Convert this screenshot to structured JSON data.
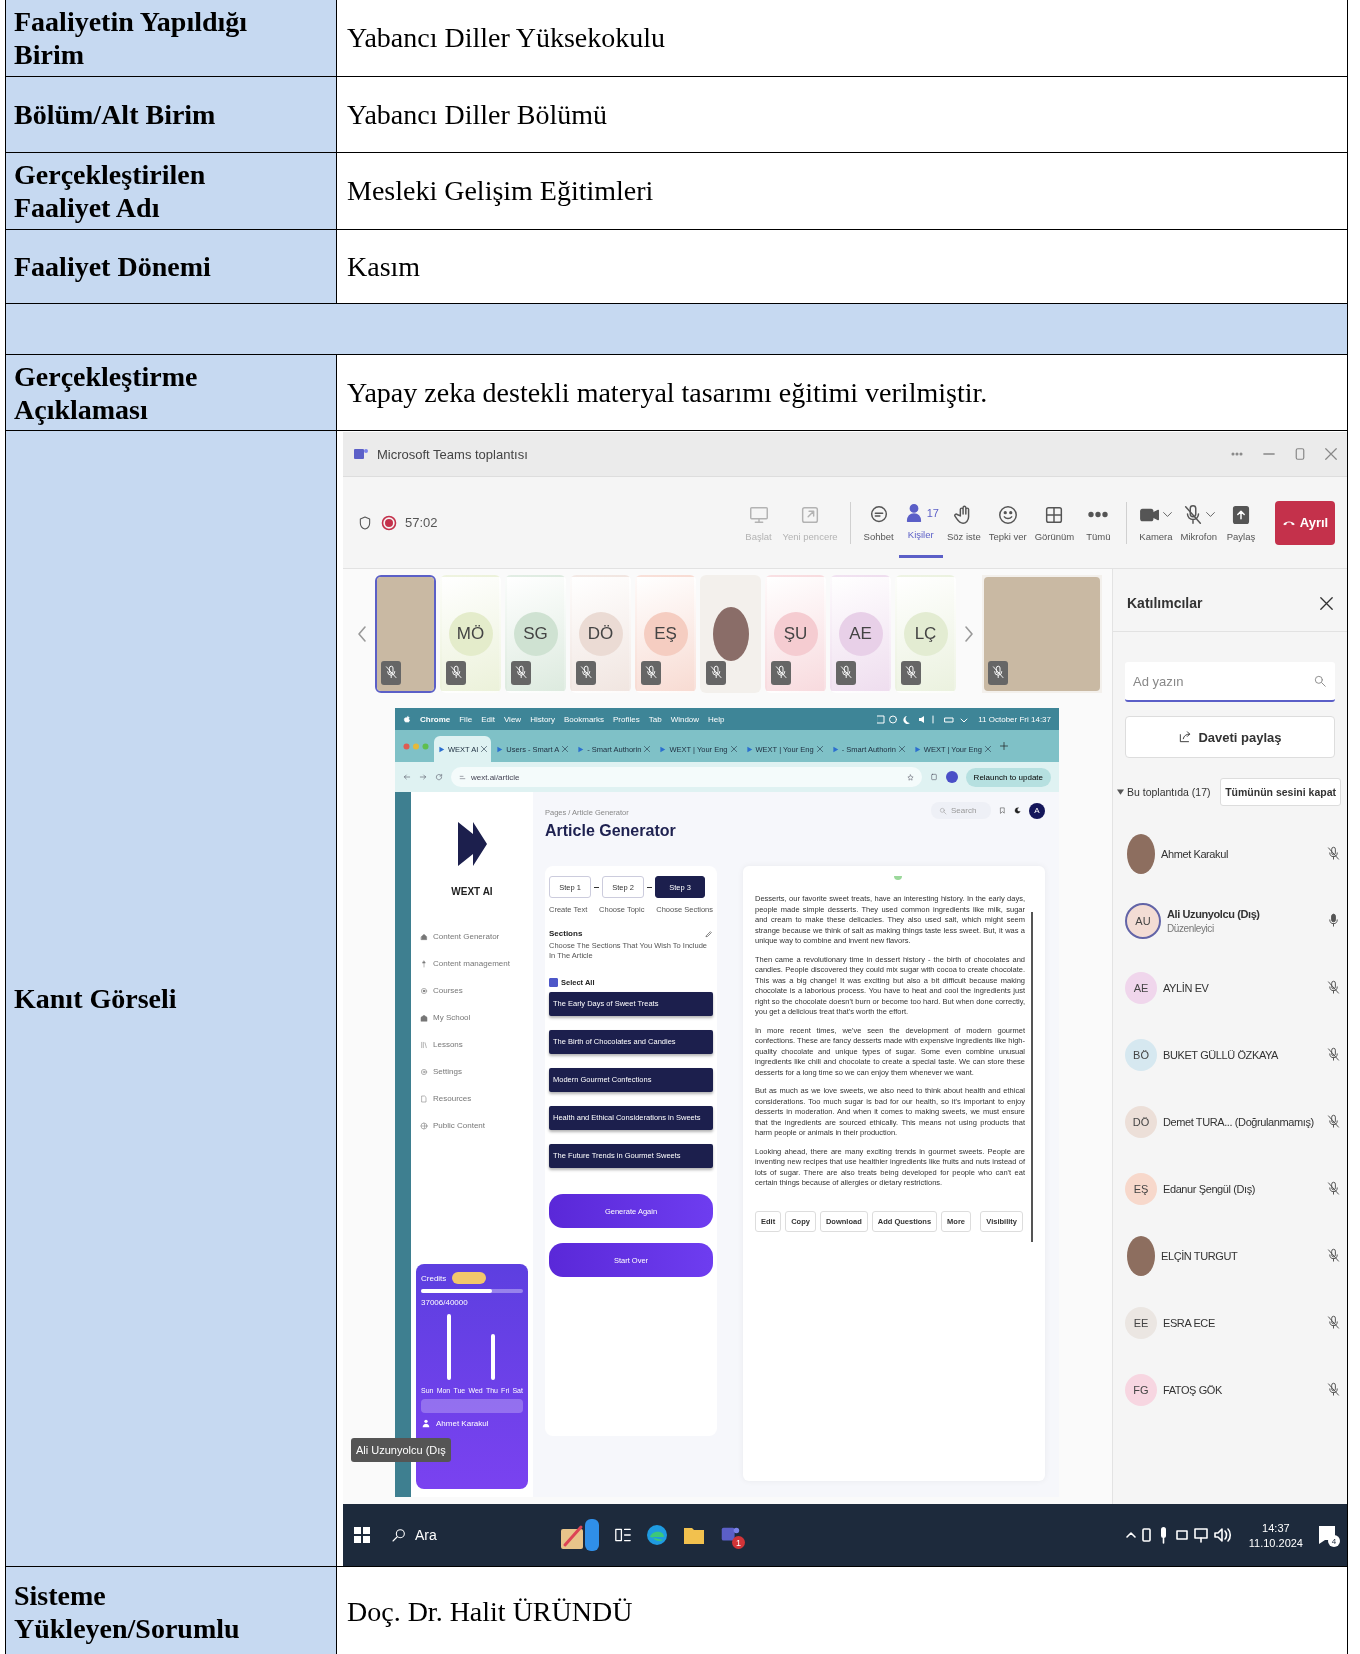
{
  "rows": [
    {
      "kind": "field",
      "label": "Faaliyetin Yapıldığı Birim",
      "value": "Yabancı Diller Yüksekokulu"
    },
    {
      "kind": "field",
      "label": "Bölüm/Alt Birim",
      "value": "Yabancı Diller Bölümü"
    },
    {
      "kind": "field",
      "label": "Gerçekleştirilen Faaliyet Adı",
      "value": "Mesleki Gelişim Eğitimleri"
    },
    {
      "kind": "field",
      "label": "Faaliyet Dönemi",
      "value": "Kasım"
    },
    {
      "kind": "spacer"
    },
    {
      "kind": "field",
      "label": "Gerçekleştirme Açıklaması",
      "value": "Yapay zeka destekli materyal tasarımı eğitimi verilmiştir."
    },
    {
      "kind": "evidence",
      "label": "Kanıt Görseli",
      "screenshot": {
        "window_title": "Microsoft Teams toplantısı",
        "recording": true,
        "timer": "57:02",
        "toolbar": [
          {
            "kind": "screen",
            "label": "Başlat",
            "disabled": true,
            "selected": false
          },
          {
            "kind": "popout",
            "label": "Yeni pencere",
            "disabled": true,
            "selected": false
          },
          {
            "kind": "chat",
            "label": "Sohbet",
            "disabled": false,
            "selected": false
          },
          {
            "kind": "people",
            "label": "Kişiler",
            "count": "17",
            "disabled": false,
            "selected": true
          },
          {
            "kind": "hand",
            "label": "Söz iste",
            "disabled": false,
            "selected": false
          },
          {
            "kind": "smile",
            "label": "Tepki ver",
            "disabled": false,
            "selected": false
          },
          {
            "kind": "grid",
            "label": "Görünüm",
            "disabled": false,
            "selected": false
          },
          {
            "kind": "more",
            "label": "Tümü",
            "disabled": false,
            "selected": false
          },
          {
            "kind": "camera",
            "label": "Kamera",
            "disabled": false,
            "selected": false
          },
          {
            "kind": "micoff",
            "label": "Mikrofon",
            "disabled": false,
            "selected": false
          },
          {
            "kind": "share",
            "label": "Paylaş",
            "disabled": false,
            "selected": false
          }
        ],
        "leave_button": "Ayrıl",
        "tiles": [
          {
            "kind": "video",
            "muted": true,
            "selected": true
          },
          {
            "kind": "initials",
            "initials": "MÖ",
            "color": "#e4eccb",
            "muted": true,
            "selected": false
          },
          {
            "kind": "initials",
            "initials": "SG",
            "color": "#cfe2d2",
            "muted": true,
            "selected": false
          },
          {
            "kind": "initials",
            "initials": "DÖ",
            "color": "#ebdbd4",
            "muted": true,
            "selected": false
          },
          {
            "kind": "initials",
            "initials": "EŞ",
            "color": "#f5cdc1",
            "muted": true,
            "selected": false
          },
          {
            "kind": "photo",
            "muted": true,
            "selected": false
          },
          {
            "kind": "initials",
            "initials": "ŞU",
            "color": "#f5ccd1",
            "muted": true,
            "selected": false
          },
          {
            "kind": "initials",
            "initials": "AE",
            "color": "#e8d0e8",
            "muted": true,
            "selected": false
          },
          {
            "kind": "initials",
            "initials": "LÇ",
            "color": "#e3ecd2",
            "muted": true,
            "selected": false
          },
          {
            "kind": "video",
            "muted": true,
            "selected": false
          }
        ],
        "name_tag": "Ali Uzunyolcu (Dış",
        "browser": {
          "menu": [
            "Chrome",
            "File",
            "Edit",
            "View",
            "History",
            "Bookmarks",
            "Profiles",
            "Tab",
            "Window",
            "Help"
          ],
          "clock": "11 October Fri 14:37",
          "tabs": [
            {
              "title": "WEXT AI",
              "selected": true
            },
            {
              "title": "Users - Smart A",
              "selected": false
            },
            {
              "title": "- Smart Authorin",
              "selected": false
            },
            {
              "title": "WEXT | Your Eng",
              "selected": false
            },
            {
              "title": "WEXT | Your Eng",
              "selected": false
            },
            {
              "title": "- Smart Authorin",
              "selected": false
            },
            {
              "title": "WEXT | Your Eng",
              "selected": false
            }
          ],
          "url": "wext.ai/article",
          "relaunch": "Relaunch to update",
          "app": {
            "logo_text": "WEXT AI",
            "nav": [
              {
                "kind": "home",
                "label": "Content Generator"
              },
              {
                "kind": "pin",
                "label": "Content management"
              },
              {
                "kind": "circle",
                "label": "Courses"
              },
              {
                "kind": "school",
                "label": "My School"
              },
              {
                "kind": "book",
                "label": "Lessons"
              },
              {
                "kind": "gear",
                "label": "Settings"
              },
              {
                "kind": "file",
                "label": "Resources"
              },
              {
                "kind": "globe",
                "label": "Public Content"
              }
            ],
            "credits": {
              "title": "Credits",
              "level": 0.7,
              "amount": "37006/40000",
              "days": [
                "Sun",
                "Mon",
                "Tue",
                "Wed",
                "Thu",
                "Fri",
                "Sat"
              ],
              "user": "Ahmet Karakul"
            },
            "breadcrumb": "Pages / Article Generator",
            "title": "Article Generator",
            "search_placeholder": "Search",
            "avatar": "A",
            "steps": [
              {
                "label": "Step 1",
                "caption": "Create Text",
                "selected": false
              },
              {
                "label": "Step 2",
                "caption": "Choose Topic",
                "selected": false
              },
              {
                "label": "Step 3",
                "caption": "Choose Sections",
                "selected": true
              }
            ],
            "sections_title": "Sections",
            "sections_hint": "Choose The Sections That You Wish To Include In The Article",
            "select_all": {
              "label": "Select All",
              "checked": true
            },
            "sections": [
              "The Early Days of Sweet Treats",
              "The Birth of Chocolates and Candies",
              "Modern Gourmet Confections",
              "Health and Ethical Considerations in Sweets",
              "The Future Trends in Gourmet Sweets"
            ],
            "buttons": [
              "Generate Again",
              "Start Over"
            ],
            "article": [
              "Desserts, our favorite sweet treats, have an interesting history. In the early days, people made simple desserts. They used common ingredients like milk, sugar and cream to make these delicacies. They also used salt, which might seem strange because we think of salt as making things taste less sweet. But, it was a unique way to combine and invent new flavors.",
              "Then came a revolutionary time in dessert history - the birth of chocolates and candies. People discovered they could mix sugar with cocoa to create chocolate. This was a big change! It was exciting but also a bit difficult because making chocolate is a laborious process. You have to heat and cool the ingredients just right so the chocolate doesn't burn or become too hard. But when done correctly, you get a delicious treat that's worth the effort.",
              "In more recent times, we've seen the development of modern gourmet confections. These are fancy desserts made with expensive ingredients like high-quality chocolate and unique types of sugar. Some even combine unusual ingredients like chili and chocolate to create a special taste. We can store these desserts for a long time so we can enjoy them whenever we want.",
              "But as much as we love sweets, we also need to think about health and ethical considerations. Too much sugar is bad for our health, so it's important to enjoy desserts in moderation. And when it comes to making sweets, we must ensure that the ingredients are sourced ethically. This means not using products that harm people or animals in their production.",
              "Looking ahead, there are many exciting trends in gourmet sweets. People are inventing new recipes that use healthier ingredients like fruits and nuts instead of lots of sugar. There are also treats being developed for people who can't eat certain things because of allergies or dietary restrictions."
            ],
            "actions": [
              "Edit",
              "Copy",
              "Download",
              "Add Questions",
              "More",
              "Visibility"
            ]
          }
        },
        "panel": {
          "title": "Katılımcılar",
          "search_placeholder": "Ad yazın",
          "invite": "Daveti paylaş",
          "group": "Bu toplantıda (17)",
          "mute_all": "Tümünün sesini kapat",
          "people": [
            {
              "kind": "photo",
              "name": "Ahmet Karakul",
              "muted": true,
              "highlighted": false
            },
            {
              "kind": "initials",
              "initials": "AU",
              "color": "#f3dcd4",
              "name": "Ali Uzunyolcu (Dış)",
              "role": "Düzenleyici",
              "muted": false,
              "highlighted": true
            },
            {
              "kind": "initials",
              "initials": "AE",
              "color": "#f0d6ec",
              "name": "AYLİN EV",
              "muted": true,
              "highlighted": false
            },
            {
              "kind": "initials",
              "initials": "BÖ",
              "color": "#d6e8f0",
              "name": "BUKET GÜLLÜ ÖZKAYA",
              "muted": true,
              "highlighted": false
            },
            {
              "kind": "initials",
              "initials": "DÖ",
              "color": "#ecdfd8",
              "name": "Demet TURA... (Doğrulanmamış)",
              "muted": true,
              "highlighted": false
            },
            {
              "kind": "initials",
              "initials": "EŞ",
              "color": "#f7d8cb",
              "name": "Edanur Şengül (Dış)",
              "muted": true,
              "highlighted": false
            },
            {
              "kind": "photo",
              "name": "ELÇİN TURGUT",
              "muted": true,
              "highlighted": false
            },
            {
              "kind": "initials",
              "initials": "EE",
              "color": "#ebe6e2",
              "name": "ESRA ECE",
              "muted": true,
              "highlighted": false
            },
            {
              "kind": "initials",
              "initials": "FG",
              "color": "#f7d6e1",
              "name": "FATOŞ GÖK",
              "muted": true,
              "highlighted": false
            }
          ]
        },
        "taskbar": {
          "search": "Ara",
          "teams_badge": "1",
          "time": "14:37",
          "date": "11.10.2024",
          "notifications": "4"
        }
      }
    },
    {
      "kind": "field",
      "label": "Sisteme Yükleyen/Sorumlu",
      "value": "Doç. Dr. Halit ÜRÜNDÜ"
    }
  ]
}
